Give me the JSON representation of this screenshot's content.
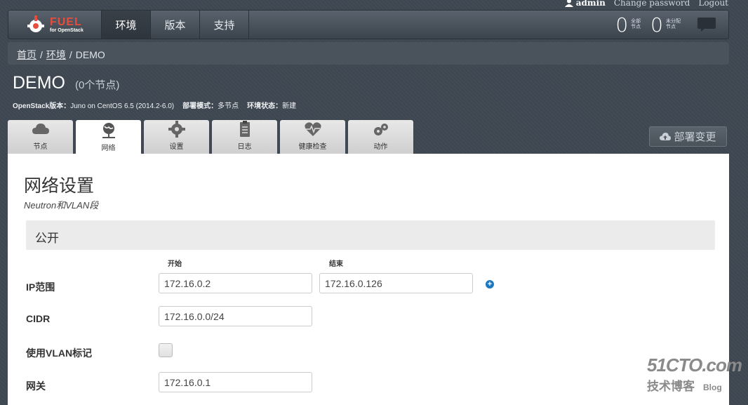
{
  "user": {
    "name": "admin",
    "change_password": "Change password",
    "logout": "Logout"
  },
  "logo": {
    "title": "FUEL",
    "subtitle": "for OpenStack"
  },
  "nav": {
    "items": [
      "环境",
      "版本",
      "支持"
    ]
  },
  "stats": {
    "total": {
      "value": "0",
      "label1": "全部",
      "label2": "节点"
    },
    "unallocated": {
      "value": "0",
      "label1": "未分配",
      "label2": "节点"
    }
  },
  "breadcrumb": {
    "home": "首页",
    "env": "环境",
    "current": "DEMO",
    "sep": "/"
  },
  "env": {
    "name": "DEMO",
    "nodes": "(0个节点)",
    "meta": [
      {
        "label": "OpenStack版本：",
        "value": "Juno on CentOS 6.5 (2014.2-6.0)"
      },
      {
        "label": "部署模式：",
        "value": "多节点"
      },
      {
        "label": "环境状态：",
        "value": "新建"
      }
    ]
  },
  "tabs": [
    {
      "label": "节点",
      "icon": "cloud-icon"
    },
    {
      "label": "网络",
      "icon": "network-icon"
    },
    {
      "label": "设置",
      "icon": "gear-icon"
    },
    {
      "label": "日志",
      "icon": "log-icon"
    },
    {
      "label": "健康检查",
      "icon": "health-icon"
    },
    {
      "label": "动作",
      "icon": "actions-icon"
    }
  ],
  "deploy_button": "部署变更",
  "network": {
    "title": "网络设置",
    "subtitle": "Neutron和VLAN段",
    "section": "公开",
    "col_start": "开始",
    "col_end": "结束",
    "ip_range_label": "IP范围",
    "ip_start": "172.16.0.2",
    "ip_end": "172.16.0.126",
    "cidr_label": "CIDR",
    "cidr": "172.16.0.0/24",
    "vlan_label": "使用VLAN标记",
    "vlan_checked": false,
    "gateway_label": "网关",
    "gateway": "172.16.0.1"
  },
  "watermark": {
    "big": "51CTO.com",
    "small": "技术博客",
    "blog": "Blog"
  }
}
